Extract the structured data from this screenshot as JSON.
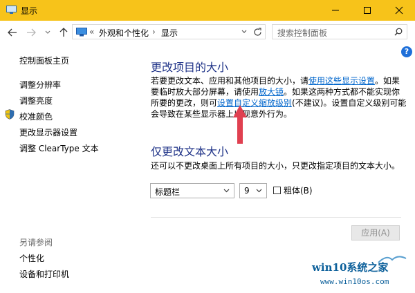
{
  "window": {
    "title": "显示"
  },
  "address": {
    "overflow": "«",
    "crumbs": [
      "外观和个性化",
      "显示"
    ]
  },
  "search": {
    "placeholder": "搜索控制面板"
  },
  "sidebar": {
    "home": "控制面板主页",
    "items": [
      "调整分辨率",
      "调整亮度",
      "校准颜色",
      "更改显示器设置",
      "调整 ClearType 文本"
    ],
    "see_also_label": "另请参阅",
    "see_also": [
      "个性化",
      "设备和打印机"
    ]
  },
  "main": {
    "section1_title": "更改项目的大小",
    "p1_part1": "若要更改文本、应用和其他项目的大小，请",
    "p1_link1": "使用这些显示设置",
    "p1_part2": "。如果要临时放大部分屏幕，请使用",
    "p1_link2": "放大镜",
    "p1_part3": "。如果这两种方式都不能实现你所要的更改，则可",
    "p1_link3": "设置自定义缩放级别",
    "p1_part4": "(不建议)。设置自定义级别可能会导致在某些显示器上出现意外行为。",
    "section2_title": "仅更改文本大小",
    "p2": "还可以不更改桌面上所有项目的大小，只更改指定项目的文本大小。",
    "item_select": "标题栏",
    "size_select": "9",
    "bold_label": "粗体(B)",
    "bold_checked": false,
    "apply_label": "应用(A)"
  },
  "help": {
    "glyph": "?"
  },
  "watermark": {
    "line1": "win10系统之家",
    "line2": "www.win10os.com"
  },
  "colors": {
    "titlebar": "#f7c31a",
    "link": "#0066cc",
    "heading": "#1e3287",
    "arrow": "#e04050"
  }
}
